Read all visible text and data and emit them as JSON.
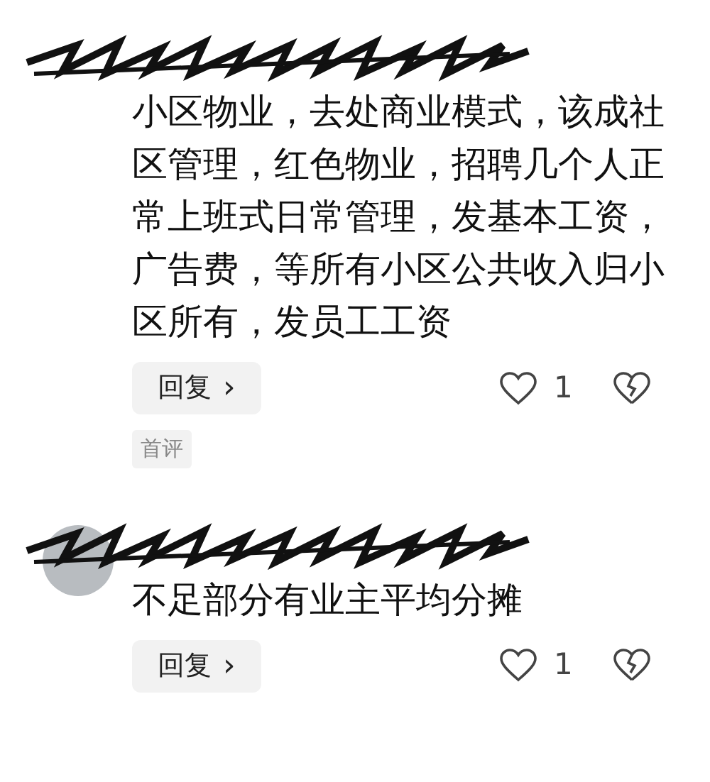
{
  "comments": [
    {
      "text": "小区物业，去处商业模式，该成社区管理，红色物业，招聘几个人正常上班式日常管理，发基本工资，广告费，等所有小区公共收入归小区所有，发员工工资",
      "reply_label": "回复",
      "reply_arrow": "›",
      "likes": "1",
      "badge": "首评"
    },
    {
      "text": "不足部分有业主平均分摊",
      "reply_label": "回复",
      "reply_arrow": "›",
      "likes": "1"
    }
  ]
}
